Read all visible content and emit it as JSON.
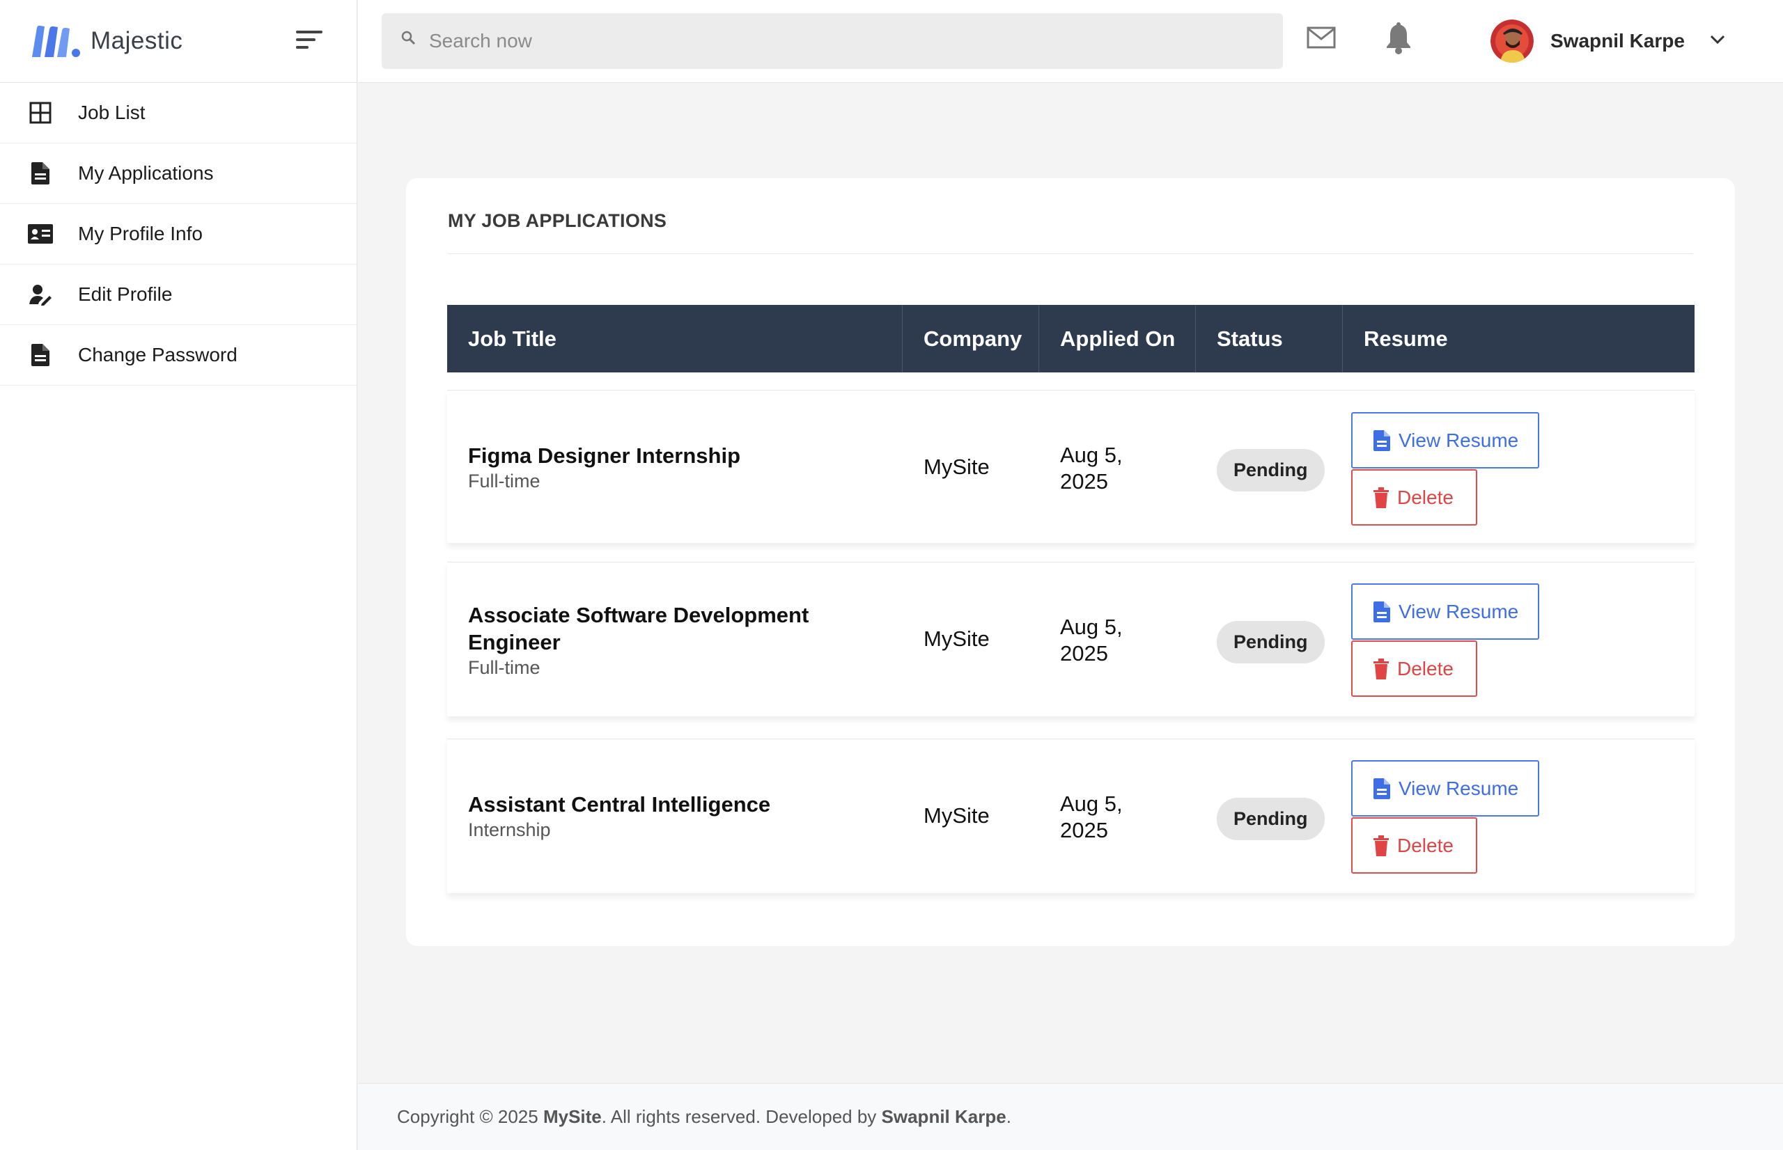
{
  "brand": {
    "name": "Majestic",
    "accent": "#4a78e8"
  },
  "sidebar": {
    "items": [
      {
        "label": "Job List",
        "icon": "grid-icon"
      },
      {
        "label": "My Applications",
        "icon": "document-icon"
      },
      {
        "label": "My Profile Info",
        "icon": "id-card-icon"
      },
      {
        "label": "Edit Profile",
        "icon": "user-edit-icon"
      },
      {
        "label": "Change Password",
        "icon": "document-icon"
      }
    ]
  },
  "topbar": {
    "search_placeholder": "Search now",
    "user_name": "Swapnil Karpe"
  },
  "main": {
    "title": "MY JOB APPLICATIONS",
    "columns": [
      "Job Title",
      "Company",
      "Applied On",
      "Status",
      "Resume"
    ],
    "rows": [
      {
        "title": "Figma Designer Internship",
        "type": "Full-time",
        "company": "MySite",
        "applied_line1": "Aug 5,",
        "applied_line2": "2025",
        "status": "Pending",
        "view_label": "View Resume",
        "delete_label": "Delete"
      },
      {
        "title": "Associate Software Development Engineer",
        "type": "Full-time",
        "company": "MySite",
        "applied_line1": "Aug 5,",
        "applied_line2": "2025",
        "status": "Pending",
        "view_label": "View Resume",
        "delete_label": "Delete"
      },
      {
        "title": "Assistant Central Intelligence",
        "type": "Internship",
        "company": "MySite",
        "applied_line1": "Aug 5,",
        "applied_line2": "2025",
        "status": "Pending",
        "view_label": "View Resume",
        "delete_label": "Delete"
      }
    ]
  },
  "footer": {
    "prefix": "Copyright © 2025 ",
    "site": "MySite",
    "middle": ". All rights reserved. Developed by ",
    "author": "Swapnil Karpe",
    "suffix": "."
  },
  "colors": {
    "table_header": "#2e3b4e",
    "view": "#4a78e8",
    "delete": "#e24b4b",
    "background": "#f4f4f4"
  }
}
